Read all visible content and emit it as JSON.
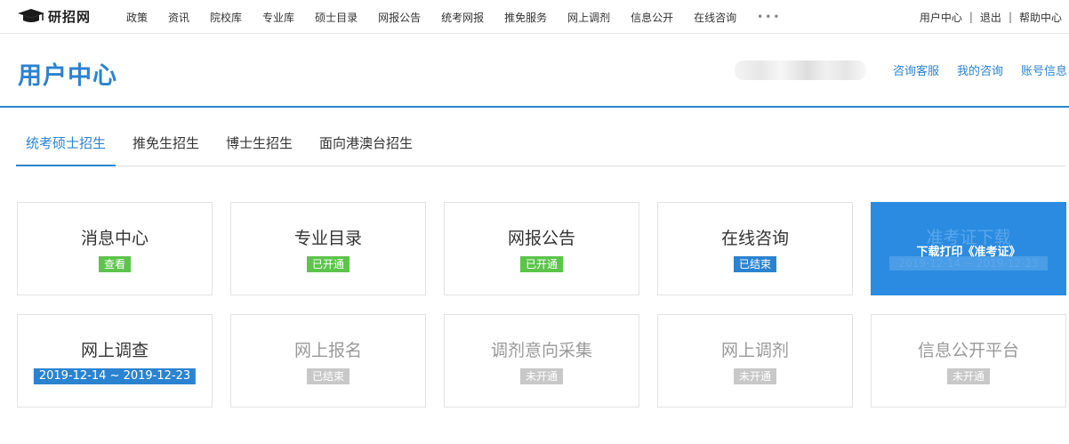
{
  "topnav": {
    "logo_text": "研招网",
    "links": [
      "政策",
      "资讯",
      "院校库",
      "专业库",
      "硕士目录",
      "网报公告",
      "统考网报",
      "推免服务",
      "网上调剂",
      "信息公开",
      "在线咨询"
    ],
    "more": "•••",
    "right_links": [
      "用户中心",
      "退出",
      "帮助中心"
    ],
    "separator": "|"
  },
  "header": {
    "title": "用户中心",
    "links": [
      "咨询客服",
      "我的咨询",
      "账号信息"
    ]
  },
  "tabs": [
    "统考硕士招生",
    "推免生招生",
    "博士生招生",
    "面向港澳台招生"
  ],
  "cards": [
    {
      "title": "消息中心",
      "badge": "查看",
      "badge_color": "#5cc44b"
    },
    {
      "title": "专业目录",
      "badge": "已开通",
      "badge_color": "#5cc44b"
    },
    {
      "title": "网报公告",
      "badge": "已开通",
      "badge_color": "#5cc44b"
    },
    {
      "title": "在线咨询",
      "badge": "已结束",
      "badge_color": "#2b83d0"
    },
    {
      "title": "准考证下载",
      "badge": "2019-12-14 ~ 2019-12-23",
      "overlay": "下载打印《准考证》",
      "background": "#2b8be0"
    },
    {
      "title": "网上调查",
      "badge": "2019-12-14 ~ 2019-12-23",
      "badge_color": "#2b83d0"
    },
    {
      "title": "网上报名",
      "badge": "已结束",
      "badge_color": "#c8c8c8"
    },
    {
      "title": "调剂意向采集",
      "badge": "未开通",
      "badge_color": "#c8c8c8"
    },
    {
      "title": "网上调剂",
      "badge": "未开通",
      "badge_color": "#c8c8c8"
    },
    {
      "title": "信息公开平台",
      "badge": "未开通",
      "badge_color": "#c8c8c8"
    }
  ],
  "colors": {
    "accent": "#2b83d0",
    "green": "#5cc44b",
    "gray": "#c8c8c8"
  }
}
